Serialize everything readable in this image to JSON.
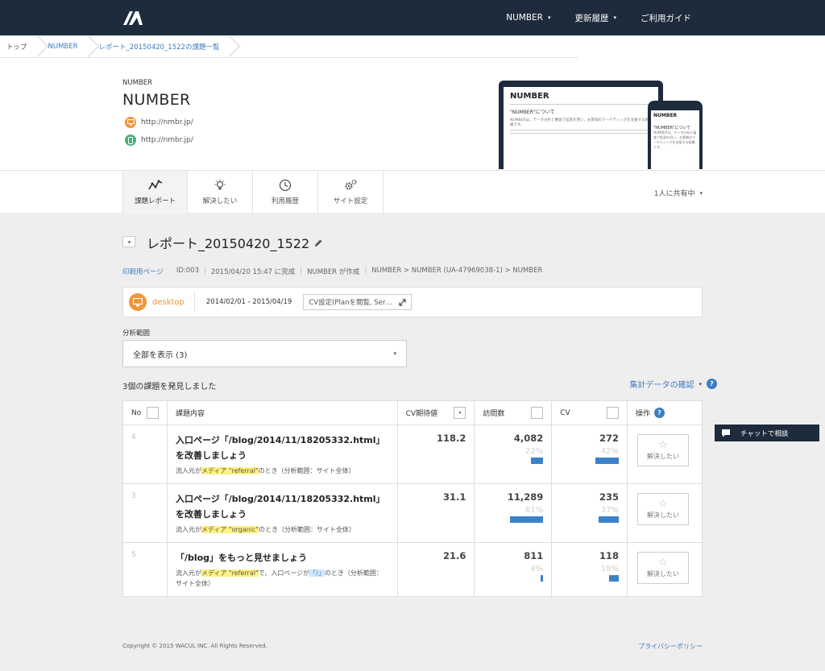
{
  "nav": {
    "items": [
      {
        "label": "NUMBER",
        "caret": "▾"
      },
      {
        "label": "更新履歴",
        "caret": "▾"
      },
      {
        "label": "ご利用ガイド",
        "caret": ""
      }
    ]
  },
  "breadcrumb": [
    "トップ",
    "NUMBER",
    "レポート_20150420_1522の課題一覧"
  ],
  "site": {
    "label": "NUMBER",
    "title": "NUMBER",
    "desktop_url": "http://nmbr.jp/",
    "mobile_url": "http://nmbr.jp/"
  },
  "mockup": {
    "laptop_title": "NUMBER",
    "laptop_heading": "\"NUMBER\"について",
    "laptop_text": "NUMBERは、データ分析と審査で拡張を用い、お客様のマーケティングを支援する組織です。",
    "phone_title": "NUMBER",
    "phone_heading": "\"NUMBER\"について",
    "phone_text": "NUMBERは、データ分析と審査で拡張を用い、お客様のマーケティングを支援する組織です。"
  },
  "tabs": [
    {
      "label": "課題レポート",
      "icon": "chart-icon",
      "active": true
    },
    {
      "label": "解決したい",
      "icon": "bulb-icon",
      "active": false
    },
    {
      "label": "利用履歴",
      "icon": "clock-icon",
      "active": false
    },
    {
      "label": "サイト設定",
      "icon": "gear-icon",
      "active": false
    }
  ],
  "share": {
    "label": "1人に共有中",
    "caret": "▾"
  },
  "report": {
    "title": "レポート_20150420_1522",
    "meta": {
      "print_link": "印刷用ページ",
      "id": "ID:003",
      "completed": "2015/04/20 15:47 に完成",
      "creator": "NUMBER が作成",
      "path": "NUMBER > NUMBER (UA-47969038-1) > NUMBER"
    }
  },
  "filter": {
    "device": "desktop",
    "date_range": "2014/02/01 - 2015/04/19",
    "cv_setting": "CV設定(Planを閲覧, Ser…"
  },
  "range": {
    "label": "分析範囲",
    "selected": "全部を表示 (3)"
  },
  "results": {
    "found": "3個の課題を発見しました",
    "confirm": "集計データの確認"
  },
  "table": {
    "headers": {
      "no": "No",
      "content": "課題内容",
      "cv_expected": "CV期待値",
      "visits": "訪問数",
      "cv": "CV",
      "action": "操作"
    },
    "solve_label": "解決したい",
    "rows": [
      {
        "no": "4",
        "title": "入口ページ「/blog/2014/11/18205332.html」を改善しましょう",
        "sub_pre": "流入元が",
        "sub_hl": "メディア \"referral\"",
        "sub_post": "のとき（分析範囲：サイト全体）",
        "sub_mid": "",
        "sub_hl2": "",
        "sub_end": "",
        "cv_expected": "118.2",
        "visits": "4,082",
        "visits_pct": "22%",
        "visits_frac": 0.22,
        "cv": "272",
        "cv_pct": "42%",
        "cv_frac": 0.42
      },
      {
        "no": "3",
        "title": "入口ページ「/blog/2014/11/18205332.html」を改善しましょう",
        "sub_pre": "流入元が",
        "sub_hl": "メディア \"organic\"",
        "sub_post": "のとき（分析範囲：サイト全体）",
        "sub_mid": "",
        "sub_hl2": "",
        "sub_end": "",
        "cv_expected": "31.1",
        "visits": "11,289",
        "visits_pct": "61%",
        "visits_frac": 0.61,
        "cv": "235",
        "cv_pct": "37%",
        "cv_frac": 0.37
      },
      {
        "no": "5",
        "title": "「/blog」をもっと見せましょう",
        "sub_pre": "流入元が",
        "sub_hl": "メディア \"referral\"",
        "sub_post": "で、入口ページが",
        "sub_mid": "",
        "sub_hl2": "「/」",
        "sub_end": "のとき（分析範囲：サイト全体）",
        "cv_expected": "21.6",
        "visits": "811",
        "visits_pct": "4%",
        "visits_frac": 0.04,
        "cv": "118",
        "cv_pct": "18%",
        "cv_frac": 0.18
      }
    ]
  },
  "chat": {
    "label": "チャットで相談"
  },
  "footer": {
    "copyright": "Copyright © 2015 WACUL INC. All Rights Reserved.",
    "privacy": "プライバシーポリシー"
  },
  "colors": {
    "navy": "#1e2b3c",
    "accent_blue": "#3c7ec2",
    "device_orange": "#f0963a",
    "mobile_green": "#4caf7a",
    "bar_blue": "#3c82c8",
    "highlight": "#fff280"
  }
}
